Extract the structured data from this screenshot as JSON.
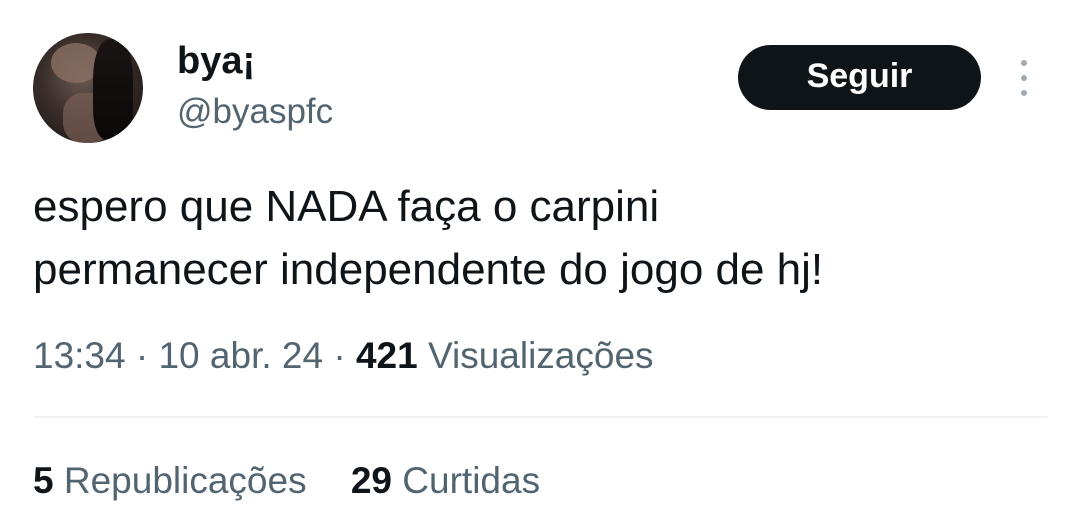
{
  "author": {
    "display_name": "bya¡",
    "handle": "@byaspfc",
    "avatar": "profile-photo"
  },
  "follow_button": {
    "label": "Seguir"
  },
  "more_menu": {
    "icon": "more-vertical-icon"
  },
  "tweet": {
    "lines": [
      "espero que NADA faça o carpini",
      "permanecer independente do jogo de hj!"
    ]
  },
  "meta": {
    "time": "13:34",
    "separator": "·",
    "date": "10 abr. 24",
    "views_count": "421",
    "views_label": "Visualizações"
  },
  "stats": {
    "reposts_count": "5",
    "reposts_label": "Republicações",
    "likes_count": "29",
    "likes_label": "Curtidas"
  },
  "colors": {
    "text": "#0f1419",
    "secondary": "#536471",
    "button_bg": "#0f1419",
    "divider": "#eff3f4"
  }
}
